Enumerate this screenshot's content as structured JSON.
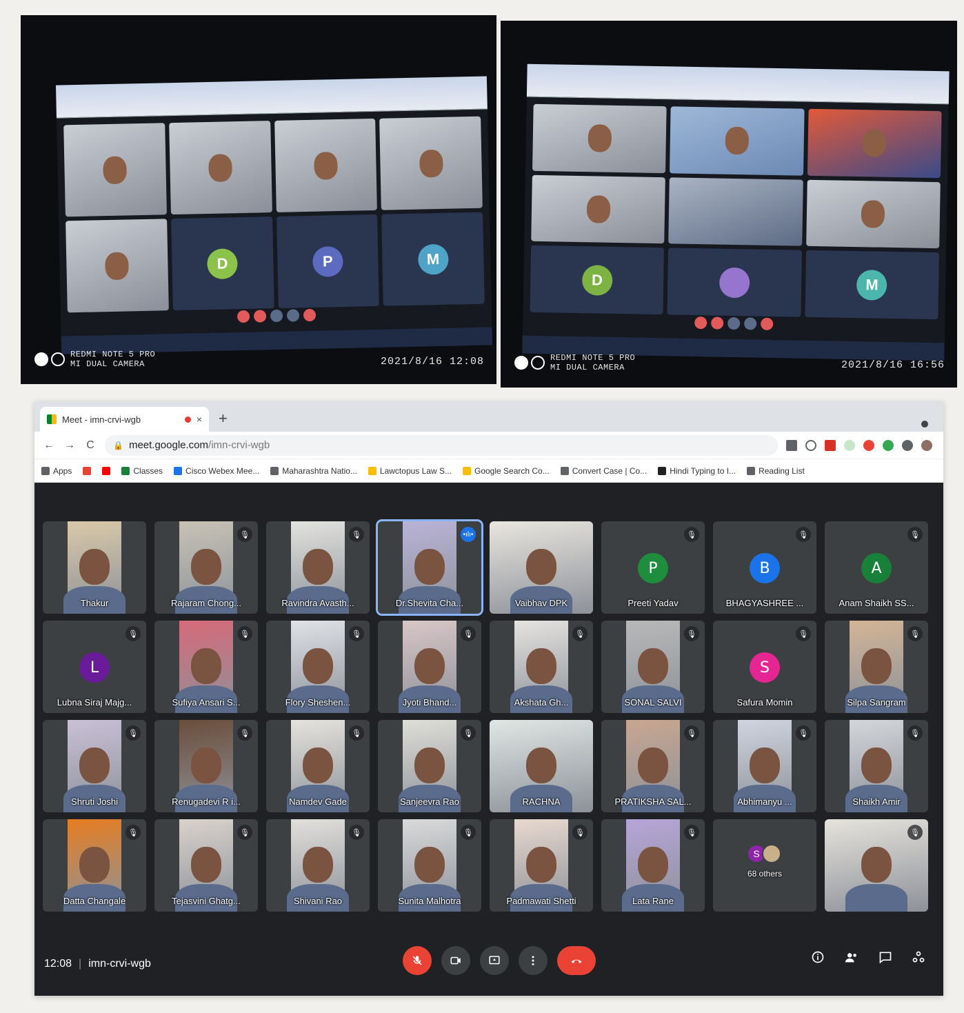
{
  "photos": {
    "left": {
      "camera_line1": "REDMI NOTE 5 PRO",
      "camera_line2": "MI DUAL CAMERA",
      "timestamp": "2021/8/16  12:08"
    },
    "right": {
      "camera_line1": "REDMI NOTE 5 PRO",
      "camera_line2": "MI DUAL CAMERA",
      "timestamp": "2021/8/16  16:56"
    },
    "left_avatars": [
      "D",
      "P",
      "M"
    ],
    "right_avatars": [
      "D",
      "M"
    ]
  },
  "browser": {
    "tab_title": "Meet - imn-crvi-wgb",
    "tab_close": "×",
    "new_tab": "+",
    "url_host": "meet.google.com",
    "url_path": "/imn-crvi-wgb",
    "nav": {
      "back": "←",
      "forward": "→",
      "reload": "C"
    },
    "bookmarks": [
      {
        "label": "Apps",
        "color": "#5f6368"
      },
      {
        "label": "Classes",
        "color": "#188038"
      },
      {
        "label": "Cisco Webex Mee...",
        "color": "#1a73e8"
      },
      {
        "label": "Maharashtra Natio...",
        "color": "#5f6368"
      },
      {
        "label": "Lawctopus Law S...",
        "color": "#fbbc04"
      },
      {
        "label": "Google Search Co...",
        "color": "#fbbc04"
      },
      {
        "label": "Convert Case | Co...",
        "color": "#5f6368"
      },
      {
        "label": "Hindi Typing to I...",
        "color": "#202124"
      },
      {
        "label": "Reading List",
        "color": "#5f6368"
      }
    ]
  },
  "meet": {
    "time": "12:08",
    "separator": "|",
    "code": "imn-crvi-wgb",
    "others_label": "68 others",
    "others_avatar": "S",
    "participants": [
      {
        "name": "Thakur",
        "type": "video",
        "muted": false,
        "bg": "#d9c9a8"
      },
      {
        "name": "Rajaram Chong...",
        "type": "video",
        "muted": true,
        "bg": "#c7c2b5"
      },
      {
        "name": "Ravindra Avasth...",
        "type": "video",
        "muted": true,
        "bg": "#e3e3df"
      },
      {
        "name": "Dr.Shevita Cha...",
        "type": "video",
        "muted": false,
        "speaking": true,
        "bg": "#b9b3d6"
      },
      {
        "name": "Vaibhav DPK",
        "type": "video",
        "muted": false,
        "full": true,
        "bg": "#e9e6df"
      },
      {
        "name": "Preeti Yadav",
        "type": "avatar",
        "letter": "P",
        "color": "#1e8e3e",
        "muted": true
      },
      {
        "name": "BHAGYASHREE ...",
        "type": "avatar",
        "letter": "B",
        "color": "#1a73e8",
        "muted": true
      },
      {
        "name": "Anam Shaikh SS...",
        "type": "avatar",
        "letter": "A",
        "color": "#188038",
        "muted": true
      },
      {
        "name": "Lubna Siraj Majg...",
        "type": "avatar",
        "letter": "L",
        "color": "#6a1b9a",
        "muted": true
      },
      {
        "name": "Sufiya Ansari S...",
        "type": "video",
        "muted": true,
        "bg": "#d76a7a"
      },
      {
        "name": "Flory Sheshen...",
        "type": "video",
        "muted": true,
        "bg": "#dfe3e7"
      },
      {
        "name": "Jyoti Bhand...",
        "type": "video",
        "muted": true,
        "bg": "#d8c6c7"
      },
      {
        "name": "Akshata Gh...",
        "type": "video",
        "muted": true,
        "bg": "#e5e3e0"
      },
      {
        "name": "SONAL SALVI",
        "type": "video",
        "muted": true,
        "bg": "#b8b8b8"
      },
      {
        "name": "Safura Momin",
        "type": "avatar",
        "letter": "S",
        "color": "#e52592",
        "muted": true
      },
      {
        "name": "Silpa Sangram",
        "type": "video",
        "muted": true,
        "bg": "#d3b596"
      },
      {
        "name": "Shruti Joshi",
        "type": "video",
        "muted": true,
        "bg": "#c9c0d6"
      },
      {
        "name": "Renugadevi R i...",
        "type": "video",
        "muted": true,
        "bg": "#6b4e3b"
      },
      {
        "name": "Namdev Gade",
        "type": "video",
        "muted": true,
        "bg": "#e5e3dd"
      },
      {
        "name": "Sanjeevra Rao",
        "type": "video",
        "muted": true,
        "bg": "#dfdfd8"
      },
      {
        "name": "RACHNA",
        "type": "video",
        "muted": false,
        "full": true,
        "bg": "#dfe7e4"
      },
      {
        "name": "PRATIKSHA SAL...",
        "type": "video",
        "muted": true,
        "bg": "#c7a790"
      },
      {
        "name": "Abhimanyu ...",
        "type": "video",
        "muted": true,
        "bg": "#cfd5df"
      },
      {
        "name": "Shaikh Amir",
        "type": "video",
        "muted": true,
        "bg": "#d3d6da"
      },
      {
        "name": "Datta Changale",
        "type": "video",
        "muted": true,
        "bg": "#e67e22"
      },
      {
        "name": "Tejasvini Ghatg...",
        "type": "video",
        "muted": true,
        "bg": "#d9d2cc"
      },
      {
        "name": "Shivani Rao",
        "type": "video",
        "muted": true,
        "bg": "#e2e0dc"
      },
      {
        "name": "Sunita Malhotra",
        "type": "video",
        "muted": true,
        "bg": "#dadada"
      },
      {
        "name": "Padmawati Shetti",
        "type": "video",
        "muted": true,
        "bg": "#e8d9cf"
      },
      {
        "name": "Lata Rane",
        "type": "video",
        "muted": true,
        "bg": "#b6a5d8"
      },
      {
        "name": "68 others",
        "type": "others"
      },
      {
        "name": "",
        "type": "video",
        "muted": true,
        "full": true,
        "bg": "#e6e3dc"
      }
    ]
  }
}
